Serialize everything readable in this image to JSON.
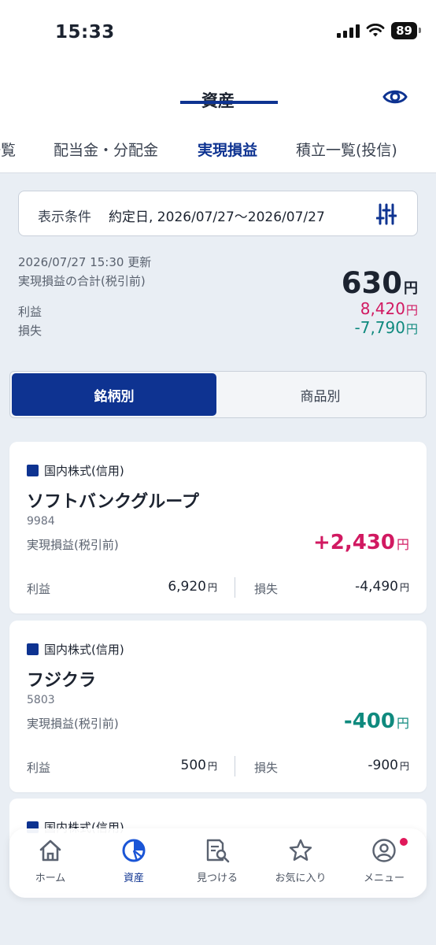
{
  "status_bar": {
    "time": "15:33",
    "battery": "89"
  },
  "header": {
    "title": "資産",
    "eye_icon": "eye-icon"
  },
  "tabs": [
    {
      "label": "一覧",
      "active": false
    },
    {
      "label": "配当金・分配金",
      "active": false
    },
    {
      "label": "実現損益",
      "active": true
    },
    {
      "label": "積立一覧(投信)",
      "active": false
    }
  ],
  "condition": {
    "label": "表示条件",
    "value": "約定日, 2026/07/27〜2026/07/27",
    "filter_icon": "filter-sliders-icon"
  },
  "summary": {
    "updated": "2026/07/27 15:30 更新",
    "total_label": "実現損益の合計(税引前)",
    "total_value": "630",
    "yen": "円",
    "profit_label": "利益",
    "profit_value": "8,420",
    "loss_label": "損失",
    "loss_value": "-7,790"
  },
  "segment": {
    "selected": "銘柄別",
    "other": "商品別"
  },
  "cards": [
    {
      "category": "国内株式(信用)",
      "name": "ソフトバンクグループ",
      "code": "9984",
      "pl_label": "実現損益(税引前)",
      "pl_value": "+2,430",
      "gain_label": "利益",
      "gain_value": "6,920",
      "loss_label": "損失",
      "loss_value": "-4,490",
      "yen": "円"
    },
    {
      "category": "国内株式(信用)",
      "name": "フジクラ",
      "code": "5803",
      "pl_label": "実現損益(税引前)",
      "pl_value": "-400",
      "gain_label": "利益",
      "gain_value": "500",
      "loss_label": "損失",
      "loss_value": "-900",
      "yen": "円"
    },
    {
      "category": "国内株式(信用)"
    }
  ],
  "nav": [
    {
      "label": "ホーム",
      "icon": "home-icon"
    },
    {
      "label": "資産",
      "icon": "assets-pie-icon",
      "active": true
    },
    {
      "label": "見つける",
      "icon": "find-document-icon"
    },
    {
      "label": "お気に入り",
      "icon": "star-icon"
    },
    {
      "label": "メニュー",
      "icon": "user-menu-icon"
    }
  ],
  "colors": {
    "brand": "#0e3391",
    "profit": "#d11961",
    "loss": "#0f8a7e",
    "badge": "#e0185a"
  }
}
